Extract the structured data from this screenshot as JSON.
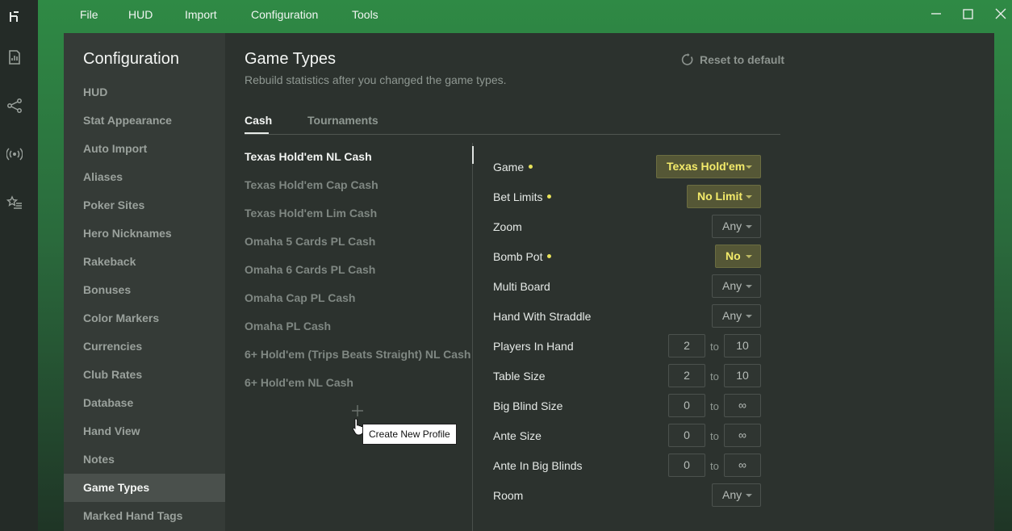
{
  "menubar": {
    "items": [
      "File",
      "HUD",
      "Import",
      "Configuration",
      "Tools"
    ]
  },
  "rail": {
    "icons": [
      "app-logo-icon",
      "reports-icon",
      "share-graph-icon",
      "broadcast-icon",
      "star-list-icon"
    ]
  },
  "sidebar": {
    "title": "Configuration",
    "items": [
      "HUD",
      "Stat Appearance",
      "Auto Import",
      "Aliases",
      "Poker Sites",
      "Hero Nicknames",
      "Rakeback",
      "Bonuses",
      "Color Markers",
      "Currencies",
      "Club Rates",
      "Database",
      "Hand View",
      "Notes",
      "Game Types",
      "Marked Hand Tags"
    ],
    "active": "Game Types"
  },
  "page": {
    "title": "Game Types",
    "subtitle": "Rebuild statistics after you changed the game types.",
    "reset_label": "Reset to default"
  },
  "tabs": {
    "cash": "Cash",
    "tournaments": "Tournaments",
    "active": "Cash"
  },
  "profiles": {
    "items": [
      "Texas Hold'em NL Cash",
      "Texas Hold'em Cap Cash",
      "Texas Hold'em Lim Cash",
      "Omaha 5 Cards PL Cash",
      "Omaha 6 Cards PL Cash",
      "Omaha Cap PL Cash",
      "Omaha PL Cash",
      "6+ Hold'em (Trips Beats Straight) NL Cash",
      "6+ Hold'em NL Cash"
    ],
    "active": "Texas Hold'em NL Cash",
    "tooltip": "Create New Profile"
  },
  "fields": {
    "game": {
      "label": "Game",
      "value": "Texas Hold'em"
    },
    "bet_limits": {
      "label": "Bet Limits",
      "value": "No Limit"
    },
    "zoom": {
      "label": "Zoom",
      "value": "Any"
    },
    "bomb_pot": {
      "label": "Bomb Pot",
      "value": "No"
    },
    "multi_board": {
      "label": "Multi Board",
      "value": "Any"
    },
    "straddle": {
      "label": "Hand With Straddle",
      "value": "Any"
    },
    "players": {
      "label": "Players In Hand",
      "from": "2",
      "to": "10"
    },
    "table_size": {
      "label": "Table Size",
      "from": "2",
      "to": "10"
    },
    "big_blind": {
      "label": "Big Blind Size",
      "from": "0",
      "to": "∞"
    },
    "ante": {
      "label": "Ante Size",
      "from": "0",
      "to": "∞"
    },
    "ante_bb": {
      "label": "Ante In Big Blinds",
      "from": "0",
      "to": "∞"
    },
    "room": {
      "label": "Room",
      "value": "Any"
    },
    "to_word": "to"
  },
  "colors": {
    "accent_yellow": "#f3ea6a",
    "highlight_bg": "#555736",
    "window_bg": "#2c322e",
    "sidebar_bg": "#353b37"
  }
}
